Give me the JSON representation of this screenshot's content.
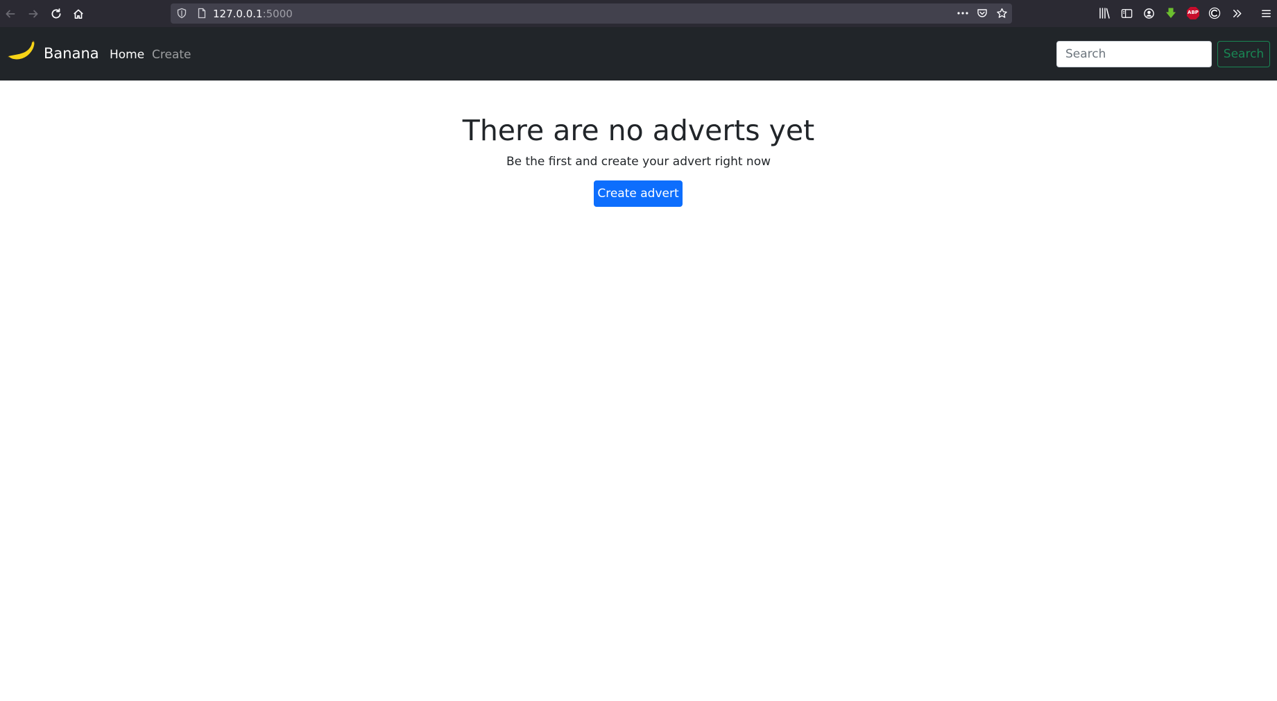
{
  "browser": {
    "url_host": "127.0.0.1",
    "url_port": ":5000",
    "icons": [
      "back-icon",
      "forward-icon",
      "reload-icon",
      "home-icon",
      "tracking-shield-icon",
      "page-icon",
      "more-icon",
      "pocket-icon",
      "bookmark-star-icon",
      "library-icon",
      "sidebar-icon",
      "account-icon",
      "download-extension-icon",
      "adblock-icon",
      "extension-icon",
      "overflow-icon",
      "menu-icon"
    ],
    "adblock_label": "ABP"
  },
  "navbar": {
    "brand": "Banana",
    "links": [
      {
        "label": "Home",
        "active": true
      },
      {
        "label": "Create",
        "active": false
      }
    ],
    "search": {
      "placeholder": "Search",
      "button_label": "Search"
    },
    "colors": {
      "background": "#212529",
      "search_button": "#198754"
    }
  },
  "main": {
    "heading": "There are no adverts yet",
    "subtext": "Be the first and create your advert right now",
    "button_label": "Create advert",
    "colors": {
      "button": "#0d6efd"
    }
  }
}
